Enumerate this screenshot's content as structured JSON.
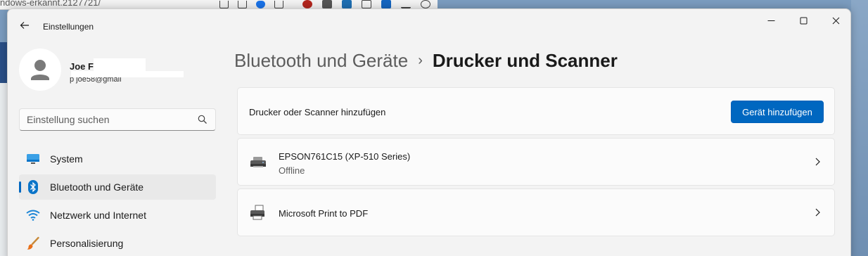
{
  "background": {
    "browser_url_fragment": "ndows-erkannt.2127721/"
  },
  "window": {
    "app_title": "Einstellungen",
    "controls": {
      "minimize": "minimize",
      "maximize": "maximize",
      "close": "close"
    }
  },
  "profile": {
    "name": "Joe F",
    "email": "p         joe58@gmail"
  },
  "search": {
    "placeholder": "Einstellung suchen"
  },
  "nav": {
    "items": [
      {
        "label": "System",
        "icon": "system-icon",
        "active": false
      },
      {
        "label": "Bluetooth und Geräte",
        "icon": "bluetooth-icon",
        "active": true
      },
      {
        "label": "Netzwerk und Internet",
        "icon": "wifi-icon",
        "active": false
      },
      {
        "label": "Personalisierung",
        "icon": "brush-icon",
        "active": false
      }
    ]
  },
  "header": {
    "parent": "Bluetooth und Geräte",
    "separator": "›",
    "current": "Drucker und Scanner"
  },
  "add_card": {
    "label": "Drucker oder Scanner hinzufügen",
    "button": "Gerät hinzufügen"
  },
  "devices": [
    {
      "name": "EPSON761C15 (XP-510 Series)",
      "status": "Offline",
      "icon": "printer-icon"
    },
    {
      "name": "Microsoft Print to PDF",
      "status": "",
      "icon": "printer-icon"
    }
  ],
  "colors": {
    "accent": "#0067c0",
    "window_bg": "#f3f3f3",
    "card_bg": "#fbfbfb"
  }
}
